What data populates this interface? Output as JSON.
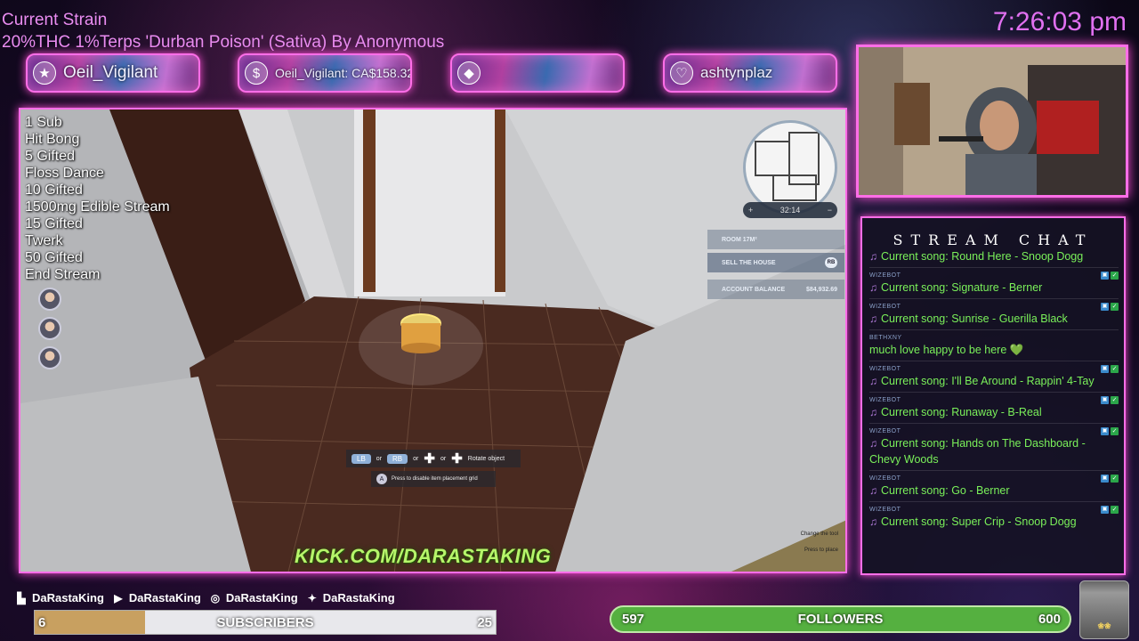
{
  "header": {
    "strain_title": "Current Strain",
    "strain_desc": "20%THC 1%Terps 'Durban Poison' (Sativa) By Anonymous",
    "clock": "7:26:03 pm"
  },
  "banners": [
    {
      "icon": "star-icon",
      "glyph": "★",
      "text": "Oeil_Vigilant"
    },
    {
      "icon": "dollar-icon",
      "glyph": "$",
      "text": "Oeil_Vigilant: CA$158.32"
    },
    {
      "icon": "diamond-icon",
      "glyph": "◆",
      "text": ""
    },
    {
      "icon": "heart-icon",
      "glyph": "♡",
      "text": "ashtynplaz"
    }
  ],
  "goals": [
    "1 Sub",
    "Hit Bong",
    "5 Gifted",
    "Floss Dance",
    "10 Gifted",
    "1500mg Edible Stream",
    "15 Gifted",
    "Twerk",
    "50 Gifted",
    "End Stream"
  ],
  "game": {
    "map_timer": "32:14",
    "map_zoom_in": "+",
    "map_zoom_out": "−",
    "menu": {
      "room": "ROOM 17M²",
      "sell": "SELL THE HOUSE",
      "sell_key": "RB",
      "balance_label": "ACCOUNT BALANCE",
      "balance_value": "$84,932.69"
    },
    "hint": {
      "lb": "LB",
      "or1": "or",
      "rb": "RB",
      "or2": "or",
      "or3": "or",
      "rotate": "Rotate object",
      "a": "A",
      "grid": "Press to disable item placement grid"
    },
    "tool_hints": {
      "change": "Change the tool",
      "place": "Press to place"
    },
    "kick": "KICK.COM/DARASTAKING"
  },
  "chat": {
    "title": "STREAM CHAT",
    "messages": [
      {
        "user": "",
        "text": "Current song: Round Here - Snoop Dogg",
        "note": true
      },
      {
        "user": "WIZEBOT",
        "text": "Current song: Signature - Berner",
        "note": true
      },
      {
        "user": "WIZEBOT",
        "text": "Current song: Sunrise - Guerilla Black",
        "note": true
      },
      {
        "user": "BETHXNY",
        "text": "much love happy to be here 💚",
        "note": false
      },
      {
        "user": "WIZEBOT",
        "text": "Current song: I'll Be Around - Rappin' 4-Tay",
        "note": true
      },
      {
        "user": "WIZEBOT",
        "text": "Current song: Runaway - B-Real",
        "note": true
      },
      {
        "user": "WIZEBOT",
        "text": "Current song: Hands on The Dashboard - Chevy Woods",
        "note": true
      },
      {
        "user": "WIZEBOT",
        "text": "Current song: Go - Berner",
        "note": true
      },
      {
        "user": "WIZEBOT",
        "text": "Current song: Super Crip - Snoop Dogg",
        "note": true
      }
    ]
  },
  "socials": [
    {
      "icon": "twitch-icon",
      "name": "DaRastaKing"
    },
    {
      "icon": "youtube-icon",
      "name": "DaRastaKing"
    },
    {
      "icon": "instagram-icon",
      "name": "DaRastaKing"
    },
    {
      "icon": "twitter-icon",
      "name": "DaRastaKing"
    }
  ],
  "subs": {
    "current": "6",
    "label": "SUBSCRIBERS",
    "goal": "25",
    "progress": 0.24
  },
  "followers": {
    "current": "597",
    "label": "FOLLOWERS",
    "goal": "600",
    "progress": 0.995
  },
  "jar_label": "❀❀"
}
